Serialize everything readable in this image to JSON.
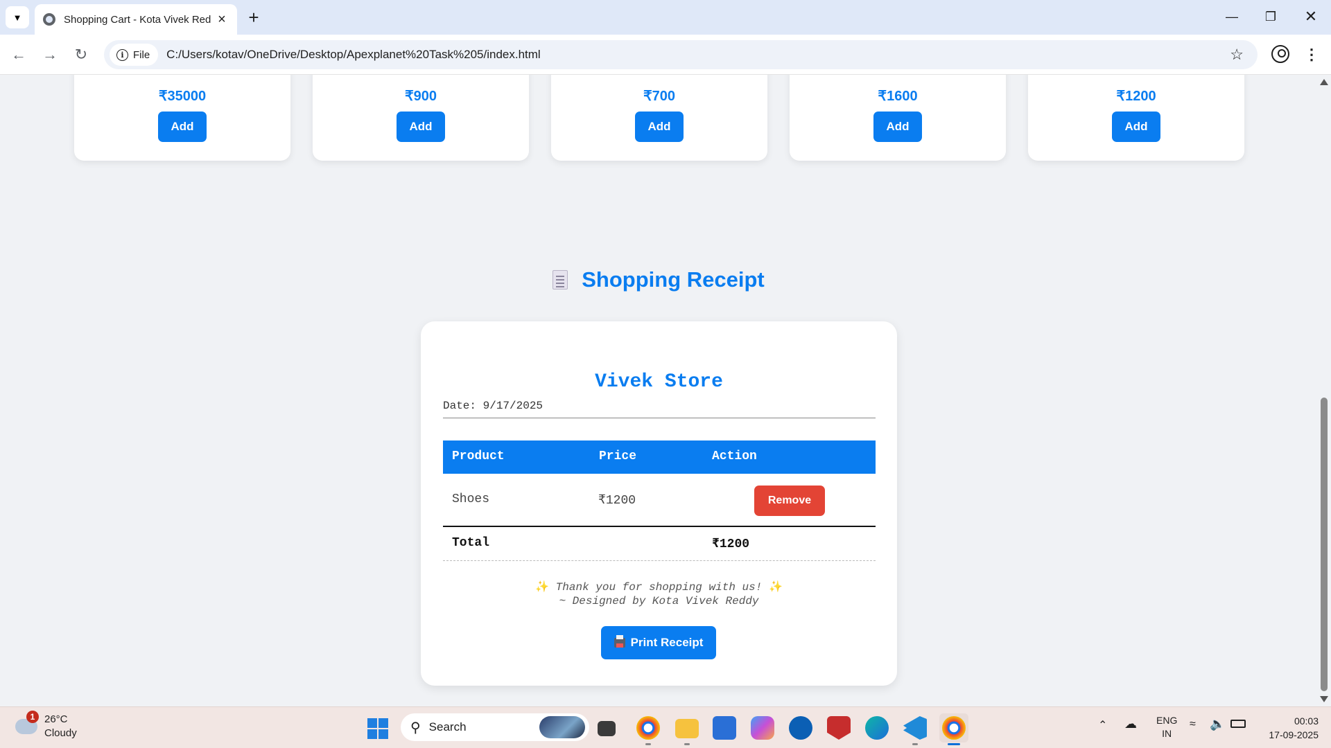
{
  "browser": {
    "tab_title": "Shopping Cart - Kota Vivek Red",
    "url_scheme": "File",
    "url": "C:/Users/kotav/OneDrive/Desktop/Apexplanet%20Task%205/index.html"
  },
  "products": [
    {
      "price": "₹35000",
      "add_label": "Add"
    },
    {
      "price": "₹900",
      "add_label": "Add"
    },
    {
      "price": "₹700",
      "add_label": "Add"
    },
    {
      "price": "₹1600",
      "add_label": "Add"
    },
    {
      "price": "₹1200",
      "add_label": "Add"
    }
  ],
  "receipt": {
    "heading": "Shopping Receipt",
    "store_name": "Vivek Store",
    "date": "Date: 9/17/2025",
    "columns": [
      "Product",
      "Price",
      "Action"
    ],
    "items": [
      {
        "product": "Shoes",
        "price": "₹1200",
        "action_label": "Remove"
      }
    ],
    "total_label": "Total",
    "total_value": "₹1200",
    "thanks_line": "Thank you for shopping with us!",
    "designer_line": "~ Designed by Kota Vivek Reddy",
    "print_label": "Print Receipt"
  },
  "taskbar": {
    "weather_temp": "26°C",
    "weather_desc": "Cloudy",
    "weather_badge": "1",
    "search_placeholder": "Search",
    "lang_top": "ENG",
    "lang_bottom": "IN",
    "time": "00:03",
    "date": "17-09-2025"
  },
  "colors": {
    "accent": "#0a7df0",
    "remove": "#e34435",
    "background": "#f0f2f5"
  }
}
